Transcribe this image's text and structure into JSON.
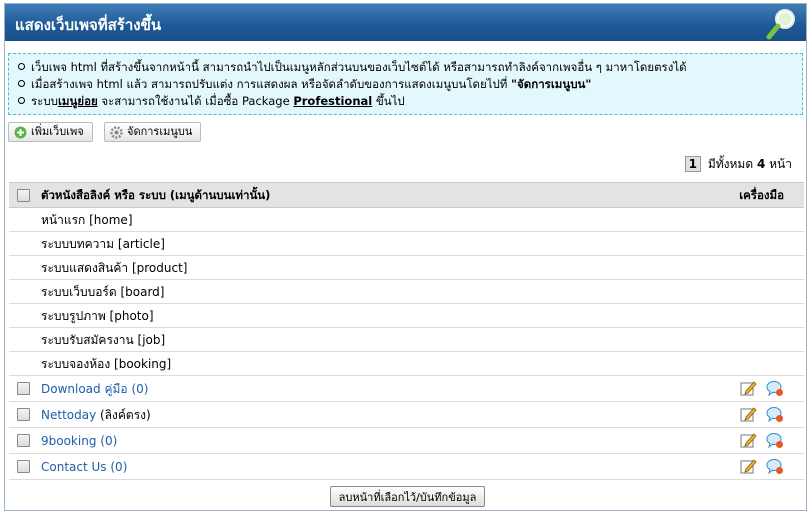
{
  "header": {
    "title": "แสดงเว็บเพจที่สร้างขึ้น",
    "icon": "magnifier-icon"
  },
  "info": {
    "line1": "เว็บเพจ html ที่สร้างขึ้นจากหน้านี้ สามารถนำไปเป็นเมนูหลักส่วนบนของเว็บไซต์ได้ หรือสามารถทำลิงค์จากเพจอื่น ๆ มาหาโดยตรงได้",
    "line2_prefix": "เมื่อสร้างเพจ html แล้ว สามารถปรับแต่ง การแสดงผล หรือจัดลำดับของการแสดงเมนูบนโดยไปที่ ",
    "line2_bold": "\"จัดการเมนูบน\"",
    "line3_prefix": "ระบบ",
    "line3_bold": "เมนูย่อย",
    "line3_mid": " จะสามารถใช้งานได้ เมื่อซื้อ Package ",
    "line3_package": "Profestional",
    "line3_suffix": " ขึ้นไป"
  },
  "toolbar": {
    "add_label": "เพิ่มเว็บเพจ",
    "manage_label": "จัดการเมนูบน"
  },
  "pager": {
    "current": "1",
    "prefix": "มีทั้งหมด",
    "total": "4",
    "suffix": "หน้า"
  },
  "table": {
    "col_name": "ตัวหนังสือลิงค์ หรือ ระบบ (เมนูด้านบนเท่านั้น)",
    "col_tools": "เครื่องมือ",
    "system_rows": [
      "หน้าแรก [home]",
      "ระบบบทความ [article]",
      "ระบบแสดงสินค้า [product]",
      "ระบบเว็บบอร์ด [board]",
      "ระบบรูปภาพ [photo]",
      "ระบบรับสมัครงาน [job]",
      "ระบบจองห้อง [booking]"
    ],
    "page_rows": [
      {
        "link": "Download คู่มือ",
        "extra": "",
        "count": "(0)"
      },
      {
        "link": "Nettoday",
        "extra": " (ลิงค์ตรง)",
        "count": ""
      },
      {
        "link": "9booking",
        "extra": "",
        "count": "(0)"
      },
      {
        "link": "Contact Us",
        "extra": "",
        "count": "(0)"
      }
    ]
  },
  "footer": {
    "save_label": "ลบหน้าที่เลือกไว้/บันทึกข้อมูล"
  },
  "colors": {
    "header": "#1f5b98",
    "info_bg": "#e2f8fd",
    "link": "#1f5ea8"
  }
}
